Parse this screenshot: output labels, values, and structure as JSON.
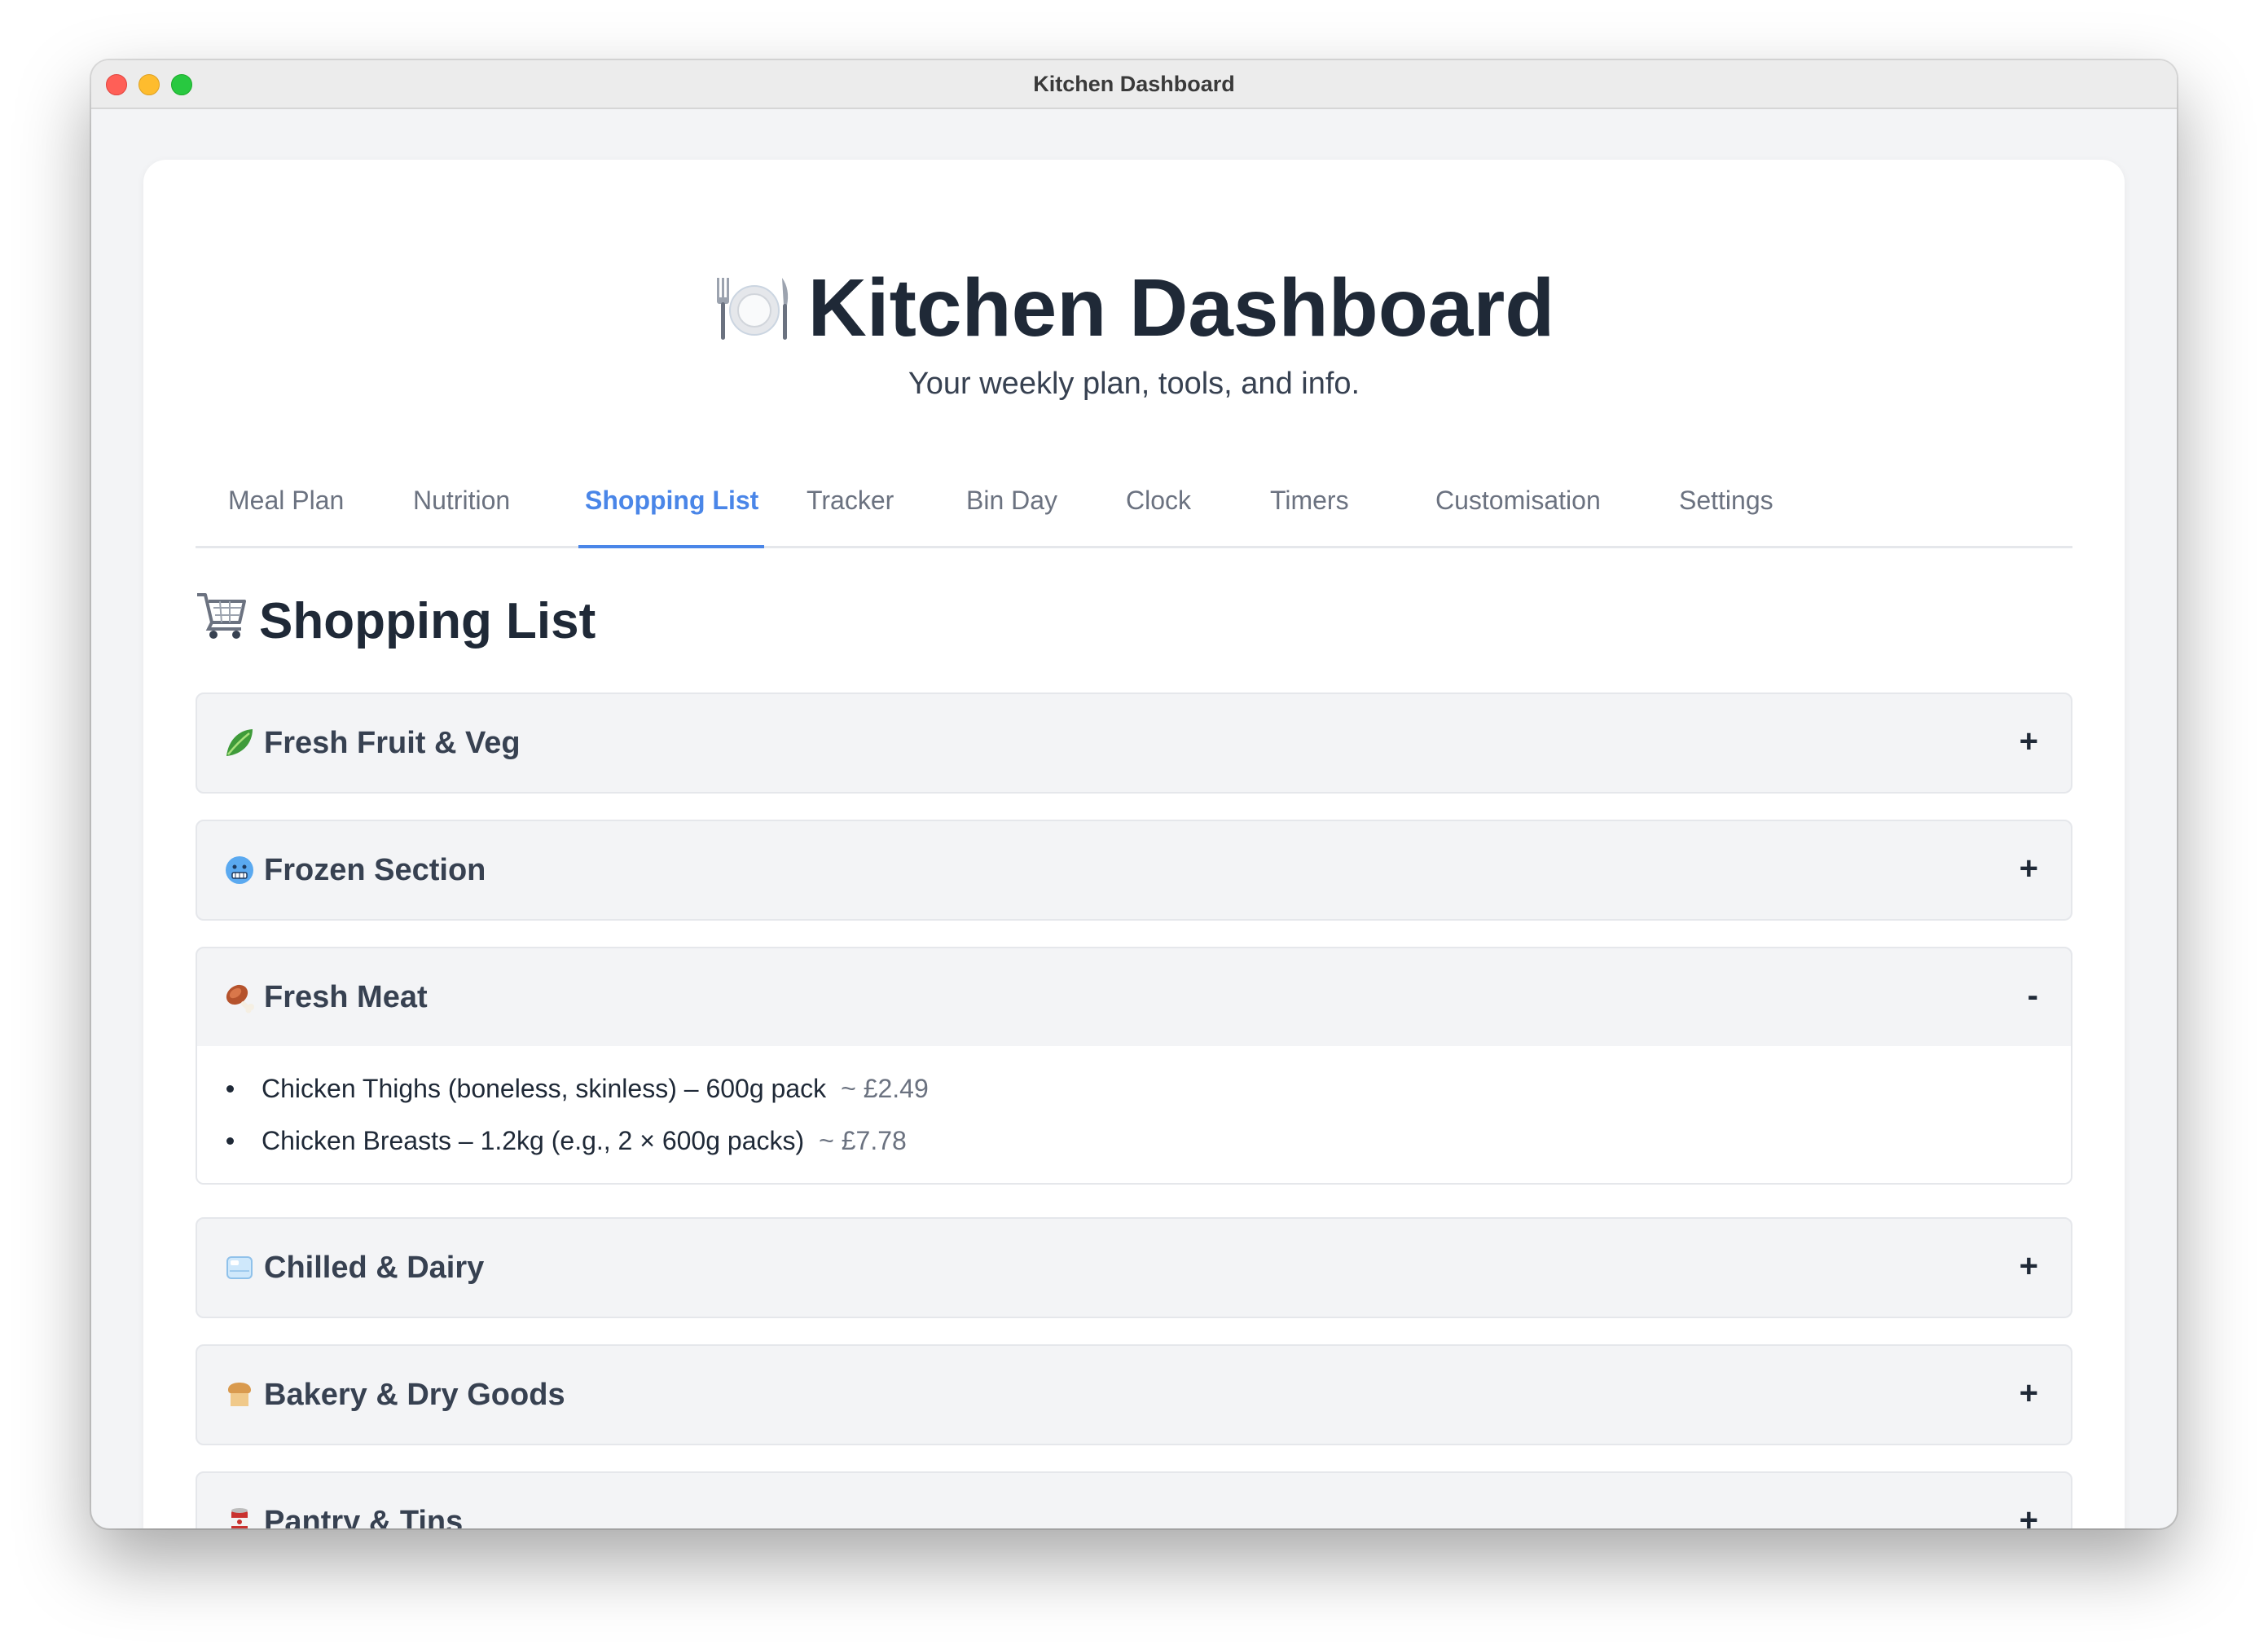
{
  "window": {
    "title": "Kitchen Dashboard"
  },
  "header": {
    "icon": "plate-cutlery-icon",
    "title": "Kitchen Dashboard",
    "subtitle": "Your weekly plan, tools, and info."
  },
  "tabs": [
    {
      "label": "Meal Plan",
      "active": false
    },
    {
      "label": "Nutrition",
      "active": false
    },
    {
      "label": "Shopping List",
      "active": true
    },
    {
      "label": "Tracker",
      "active": false
    },
    {
      "label": "Bin Day",
      "active": false
    },
    {
      "label": "Clock",
      "active": false
    },
    {
      "label": "Timers",
      "active": false
    },
    {
      "label": "Customisation",
      "active": false
    },
    {
      "label": "Settings",
      "active": false
    }
  ],
  "section": {
    "icon": "shopping-cart-icon",
    "title": "Shopping List"
  },
  "categories": [
    {
      "icon": "leafy-greens-icon",
      "label": "Fresh Fruit & Veg",
      "toggle": "+",
      "expanded": false
    },
    {
      "icon": "cold-face-icon",
      "label": "Frozen Section",
      "toggle": "+",
      "expanded": false
    },
    {
      "icon": "meat-on-bone-icon",
      "label": "Fresh Meat",
      "toggle": "-",
      "expanded": true,
      "items": [
        {
          "name": "Chicken Thighs (boneless, skinless) – 600g pack",
          "price": "~ £2.49"
        },
        {
          "name": "Chicken Breasts – 1.2kg (e.g., 2 × 600g packs)",
          "price": "~ £7.78"
        }
      ]
    },
    {
      "icon": "ice-cube-icon",
      "label": "Chilled & Dairy",
      "toggle": "+",
      "expanded": false
    },
    {
      "icon": "bread-icon",
      "label": "Bakery & Dry Goods",
      "toggle": "+",
      "expanded": false
    },
    {
      "icon": "tin-can-icon",
      "label": "Pantry & Tins",
      "toggle": "+",
      "expanded": false
    }
  ],
  "colors": {
    "accent": "#4a86e8",
    "text_dark": "#1f2937",
    "text_muted": "#6b7280",
    "panel_bg": "#f3f4f6"
  }
}
